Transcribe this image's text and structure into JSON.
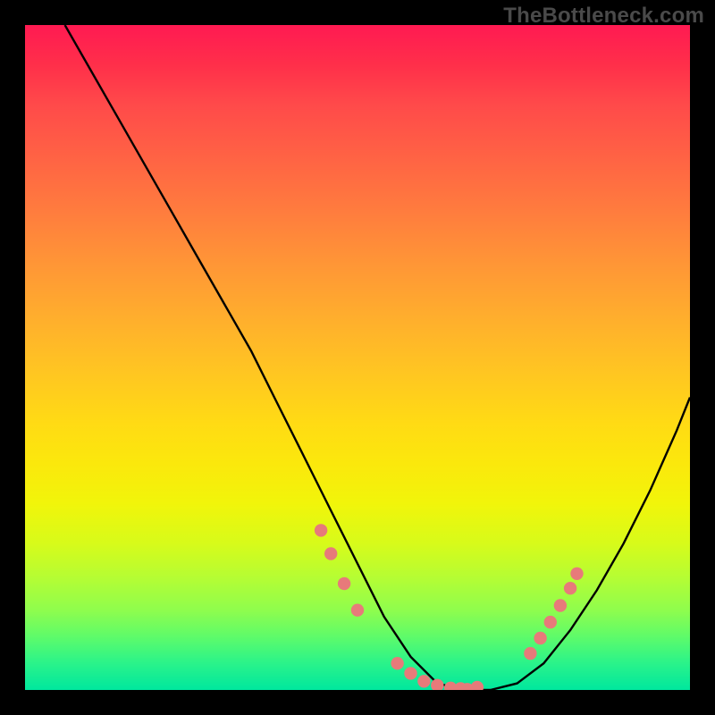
{
  "watermark": "TheBottleneck.com",
  "colors": {
    "dot": "#e77a7a",
    "curve": "#000000",
    "frame": "#000000"
  },
  "chart_data": {
    "type": "line",
    "title": "",
    "xlabel": "",
    "ylabel": "",
    "xlim": [
      0,
      100
    ],
    "ylim": [
      0,
      100
    ],
    "grid": false,
    "series": [
      {
        "name": "bottleneck-curve",
        "x": [
          6,
          10,
          14,
          18,
          22,
          26,
          30,
          34,
          38,
          42,
          46,
          50,
          54,
          58,
          62,
          66,
          70,
          74,
          78,
          82,
          86,
          90,
          94,
          98,
          100
        ],
        "y": [
          100,
          93,
          86,
          79,
          72,
          65,
          58,
          51,
          43,
          35,
          27,
          19,
          11,
          5,
          1,
          0,
          0,
          1,
          4,
          9,
          15,
          22,
          30,
          39,
          44
        ]
      }
    ],
    "marked_points": {
      "name": "highlight-zone",
      "x": [
        44.5,
        46,
        48,
        50,
        56,
        58,
        60,
        62,
        64,
        65.5,
        66.5,
        68,
        76,
        77.5,
        79,
        80.5,
        82,
        83
      ],
      "y": [
        24,
        20.5,
        16,
        12,
        4,
        2.5,
        1.3,
        0.7,
        0.3,
        0.2,
        0.1,
        0.4,
        5.5,
        7.8,
        10.2,
        12.7,
        15.3,
        17.5
      ]
    }
  }
}
